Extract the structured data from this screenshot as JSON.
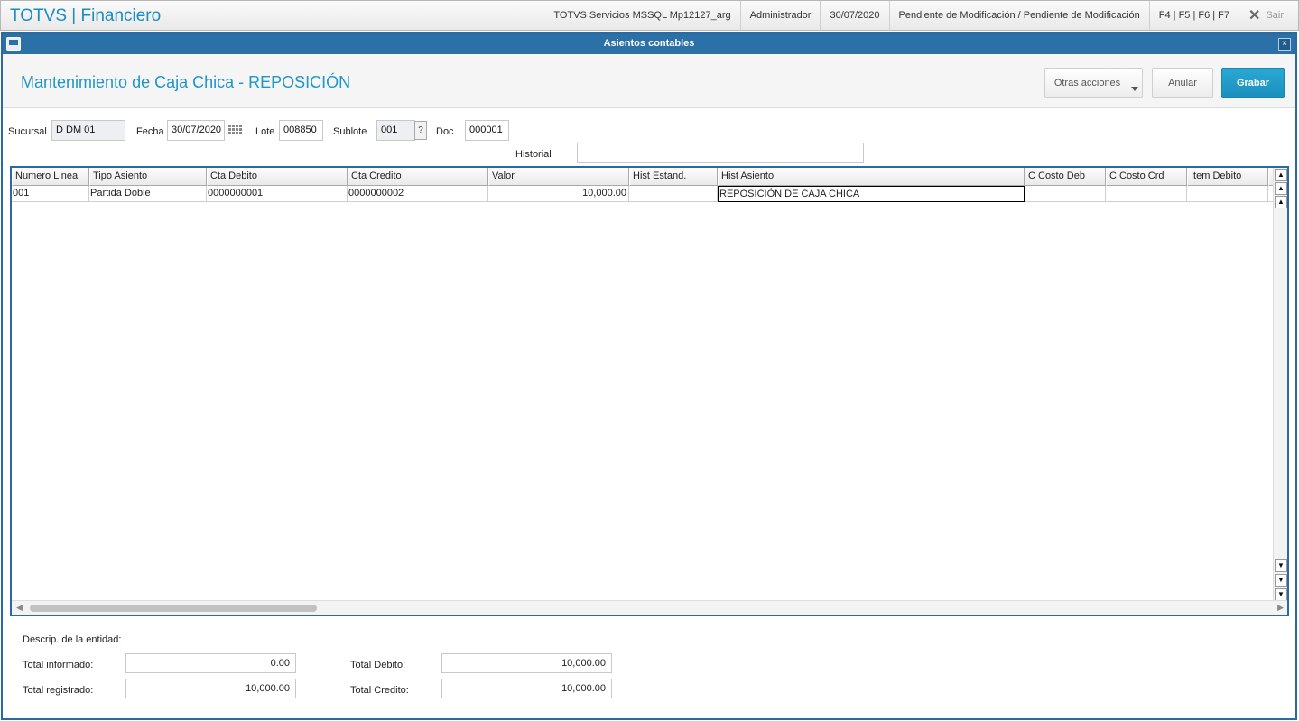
{
  "topbar": {
    "app_title": "TOTVS | Financiero",
    "environment": "TOTVS Servicios MSSQL Mp12127_arg",
    "user": "Administrador",
    "date": "30/07/2020",
    "status": "Pendiente de Modificación / Pendiente de Modificación",
    "shortcuts": "F4 | F5 | F6 | F7",
    "exit_label": "Sair",
    "exit_icon": "close-icon"
  },
  "dialog": {
    "title": "Asientos contables",
    "close_glyph": "×"
  },
  "header": {
    "page_title": "Mantenimiento de Caja Chica - REPOSICIÓN",
    "otras_label": "Otras acciones",
    "anular_label": "Anular",
    "grabar_label": "Grabar"
  },
  "form": {
    "sucursal_label": "Sucursal",
    "sucursal_value": "D DM 01",
    "fecha_label": "Fecha",
    "fecha_value": "30/07/2020",
    "lote_label": "Lote",
    "lote_value": "008850",
    "sublote_label": "Sublote",
    "sublote_value": "001",
    "sublote_help": "?",
    "doc_label": "Doc",
    "doc_value": "000001",
    "historial_label": "Historial",
    "historial_value": ""
  },
  "grid": {
    "columns": [
      "Numero Linea",
      "Tipo Asiento",
      "Cta Debito",
      "Cta Credito",
      "Valor",
      "Hist Estand.",
      "Hist Asiento",
      "C Costo Deb",
      "C Costo Crd",
      "Item Debito",
      ""
    ],
    "rows": [
      [
        "001",
        "Partida Doble",
        "0000000001",
        "0000000002",
        "10,000.00",
        "",
        "REPOSICIÓN DE CAJA CHICA",
        "",
        "",
        "",
        ""
      ]
    ]
  },
  "totals": {
    "descrip_label": "Descrip. de la entidad:",
    "informado_label": "Total informado:",
    "informado_value": "0.00",
    "registrado_label": "Total registrado:",
    "registrado_value": "10,000.00",
    "debito_label": "Total Debito:",
    "debito_value": "10,000.00",
    "credito_label": "Total Credito:",
    "credito_value": "10,000.00"
  }
}
